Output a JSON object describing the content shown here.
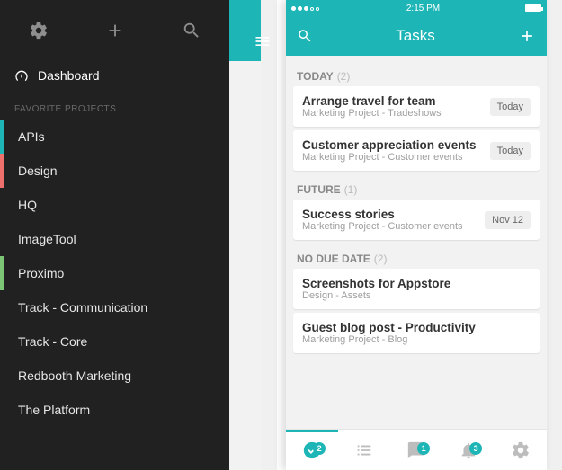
{
  "status": {
    "time": "2:15 PM"
  },
  "header": {
    "title": "Tasks"
  },
  "sidebar": {
    "dashboard_label": "Dashboard",
    "section_label": "FAVORITE PROJECTS",
    "projects": [
      {
        "label": "APIs",
        "color": "teal"
      },
      {
        "label": "Design",
        "color": "coral"
      },
      {
        "label": "HQ",
        "color": "none"
      },
      {
        "label": "ImageTool",
        "color": "none"
      },
      {
        "label": "Proximo",
        "color": "green"
      },
      {
        "label": "Track - Communication",
        "color": "none"
      },
      {
        "label": "Track - Core",
        "color": "none"
      },
      {
        "label": "Redbooth Marketing",
        "color": "none"
      },
      {
        "label": "The Platform",
        "color": "none"
      }
    ]
  },
  "sections": [
    {
      "name": "TODAY",
      "count": "(2)",
      "tasks": [
        {
          "title": "Arrange travel for team",
          "subtitle": "Marketing Project - Tradeshows",
          "due": "Today"
        },
        {
          "title": "Customer appreciation events",
          "subtitle": "Marketing Project - Customer events",
          "due": "Today"
        }
      ]
    },
    {
      "name": "FUTURE",
      "count": "(1)",
      "tasks": [
        {
          "title": "Success stories",
          "subtitle": "Marketing Project - Customer events",
          "due": "Nov 12"
        }
      ]
    },
    {
      "name": "NO DUE DATE",
      "count": "(2)",
      "tasks": [
        {
          "title": "Screenshots for Appstore",
          "subtitle": "Design - Assets",
          "due": ""
        },
        {
          "title": "Guest blog post - Productivity",
          "subtitle": "Marketing Project - Blog",
          "due": ""
        }
      ]
    }
  ],
  "partial_sections": [
    {
      "name": "TODA",
      "tasks": [
        {
          "t": "Arr"
        },
        {
          "t": "Cu"
        }
      ]
    },
    {
      "name": "FUTU",
      "tasks": [
        {
          "t": "Suc"
        }
      ]
    },
    {
      "name": "NO D",
      "tasks": [
        {
          "t": "Scr"
        },
        {
          "t": "Gu"
        }
      ]
    }
  ],
  "tabs": {
    "badges": {
      "tasks": "2",
      "chat": "1",
      "bell": "3"
    }
  }
}
